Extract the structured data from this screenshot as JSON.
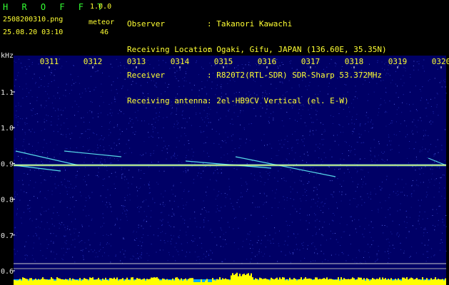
{
  "header": {
    "app_title": "H R O F F T",
    "app_version": "1.0.0",
    "filename": "2508200310.png",
    "datetime": "25.08.20 03:10",
    "meteor_label": "meteor",
    "meteor_count": "46"
  },
  "info": [
    {
      "label": "Observer",
      "value": ": Takanori Kawachi"
    },
    {
      "label": "Receiving Location",
      "value": ": Ogaki, Gifu, JAPAN (136.60E, 35.35N)"
    },
    {
      "label": "Receiver",
      "value": ": R820T2(RTL-SDR) SDR-Sharp 53.372MHz"
    },
    {
      "label": "Receiving antenna",
      "value": ": 2el-HB9CV Vertical (el. E-W)"
    }
  ],
  "spectrogram": {
    "y_unit": "kHz",
    "y_ticks": [
      "1.1",
      "1.0",
      "0.9",
      "0.8",
      "0.7",
      "0.6"
    ],
    "time_ticks": [
      "0311",
      "0312",
      "0313",
      "0314",
      "0315",
      "0316",
      "0317",
      "0318",
      "0319",
      "0320"
    ],
    "carrier_khz": 0.895,
    "colors": {
      "background": "#000066",
      "noise": "#3344dd",
      "carrier": "#ffff66",
      "trail": "#66ffff",
      "grid": "#ffffff",
      "tick_text": "#ffff33",
      "axis_text": "#e8e8e8",
      "level_bars": "#ffff00",
      "level_base": "#00aaff"
    }
  }
}
